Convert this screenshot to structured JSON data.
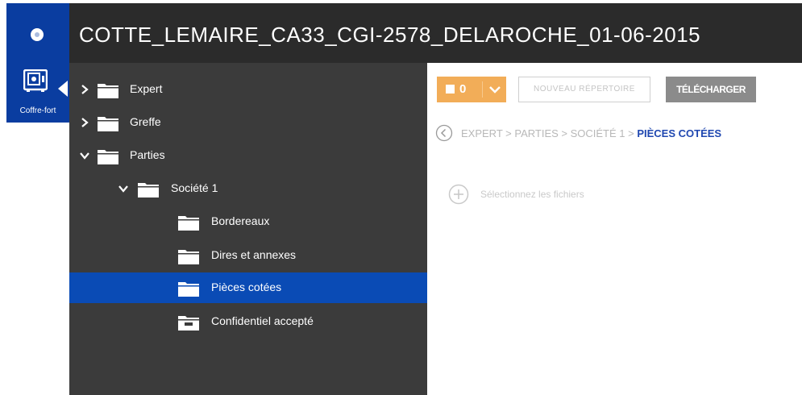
{
  "window": {
    "title": "COTTE_LEMAIRE_CA33_CGI-2578_DELAROCHE_01-06-2015"
  },
  "rail": {
    "items": [
      {
        "label": "Coffre-fort",
        "icon": "safe-icon"
      }
    ]
  },
  "tree": {
    "items": [
      {
        "label": "Expert",
        "level": 0,
        "chevron": "right",
        "selected": false
      },
      {
        "label": "Greffe",
        "level": 0,
        "chevron": "right",
        "selected": false
      },
      {
        "label": "Parties",
        "level": 0,
        "chevron": "down",
        "selected": false
      },
      {
        "label": "Société 1",
        "level": 1,
        "chevron": "down",
        "selected": false
      },
      {
        "label": "Bordereaux",
        "level": 2,
        "chevron": "none",
        "selected": false
      },
      {
        "label": "Dires et annexes",
        "level": 2,
        "chevron": "none",
        "selected": false
      },
      {
        "label": "Pièces cotées",
        "level": 2,
        "chevron": "none",
        "selected": true
      },
      {
        "label": "Confidentiel accepté",
        "level": 2,
        "chevron": "none",
        "selected": false,
        "icon": "locked-folder-icon"
      }
    ]
  },
  "toolbar": {
    "selection_count": "0",
    "new_folder_label": "NOUVEAU RÉPERTOIRE",
    "download_label": "TÉLÉCHARGER"
  },
  "breadcrumb": {
    "trail": "EXPERT > PARTIES > SOCIÉTÉ 1 > ",
    "current": "PIÈCES COTÉES"
  },
  "upload": {
    "label": "Sélectionnez les fichiers"
  },
  "colors": {
    "brand_blue": "#0a3da0",
    "selected_blue": "#0a4bb5",
    "tree_background": "#3b3b3b",
    "topbar_background": "#2b2b2b",
    "accent_orange": "#f2ad58",
    "download_gray": "#8b8b8b",
    "breadcrumb_current": "#1f47b0"
  }
}
